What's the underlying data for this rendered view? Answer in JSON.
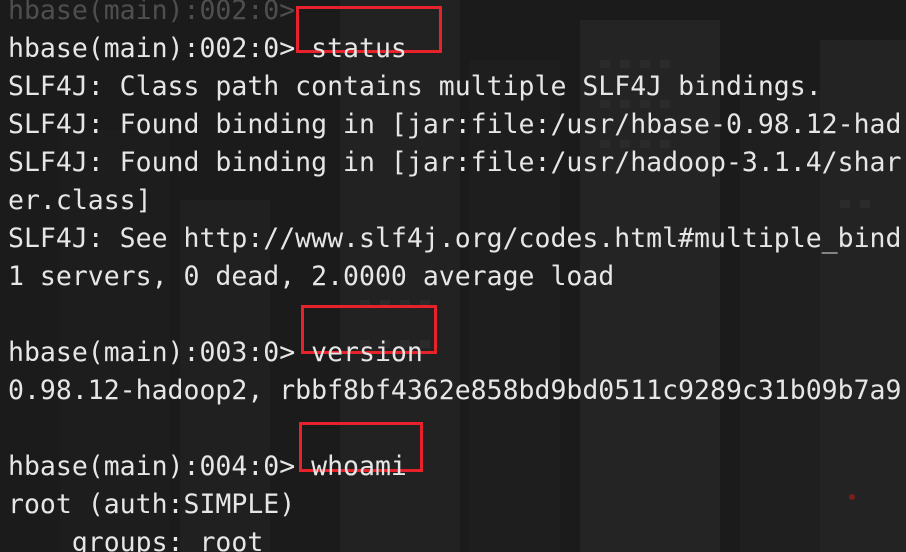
{
  "terminal": {
    "lines": [
      {
        "text": "hbase(main):002:0> "
      },
      {
        "text": "hbase(main):002:0> ",
        "command": "status"
      },
      {
        "text": "SLF4J: Class path contains multiple SLF4J bindings."
      },
      {
        "text": "SLF4J: Found binding in [jar:file:/usr/hbase-0.98.12-had"
      },
      {
        "text": "SLF4J: Found binding in [jar:file:/usr/hadoop-3.1.4/shar"
      },
      {
        "text": "er.class]"
      },
      {
        "text": "SLF4J: See http://www.slf4j.org/codes.html#multiple_bind"
      },
      {
        "text": "1 servers, 0 dead, 2.0000 average load"
      },
      {
        "text": ""
      },
      {
        "text": "hbase(main):003:0> ",
        "command": "version"
      },
      {
        "text": "0.98.12-hadoop2, rbbf8bf4362e858bd9bd0511c9289c31b09b7a9"
      },
      {
        "text": ""
      },
      {
        "text": "hbase(main):004:0> ",
        "command": "whoami"
      },
      {
        "text": "root (auth:SIMPLE)"
      },
      {
        "text": "    groups: root"
      }
    ]
  },
  "colors": {
    "text": "#e6e6e6",
    "highlight": "#e8222a",
    "background": "#1a1a1a"
  }
}
